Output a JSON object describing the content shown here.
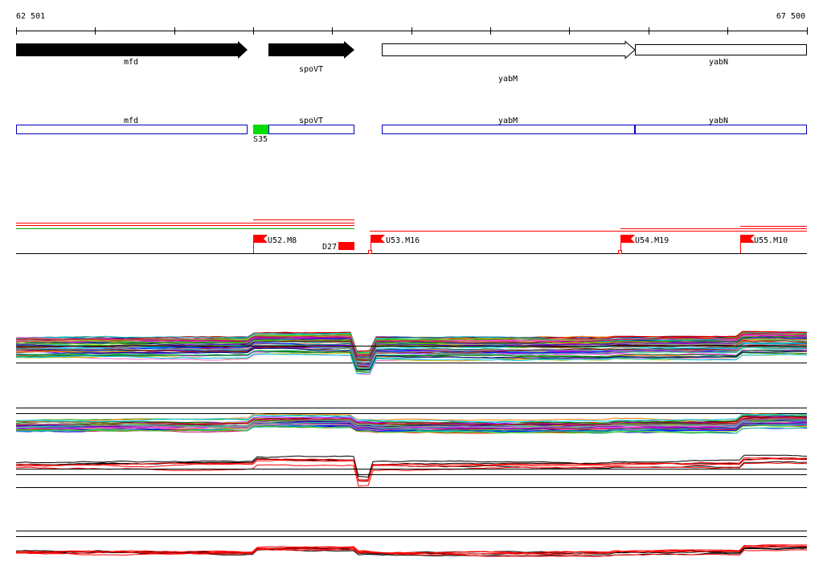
{
  "ruler": {
    "start_label": "62 501",
    "end_label": "67 500"
  },
  "genes": [
    {
      "label": "mfd",
      "style": "filled"
    },
    {
      "label": "spoVT",
      "style": "filled"
    },
    {
      "label": "yabM",
      "style": "outline"
    },
    {
      "label": "yabN",
      "style": "outline"
    }
  ],
  "annotation_boxes": [
    {
      "label": "mfd"
    },
    {
      "label": "spoVT"
    },
    {
      "label": "yabM"
    },
    {
      "label": "yabN"
    }
  ],
  "marker": {
    "label": "S35",
    "color": "#00dd00"
  },
  "flags": [
    {
      "label": "U52.M8",
      "color": "#ff0000"
    },
    {
      "label": "U53.M16",
      "color": "#ff0000"
    },
    {
      "label": "U54.M19",
      "color": "#ff0000"
    },
    {
      "label": "U55.M10",
      "color": "#ff0000"
    }
  ],
  "deletion": {
    "label": "D27",
    "color": "#ff0000"
  },
  "colors": {
    "line_primary": "#ff0000",
    "line_secondary": "#000000",
    "box_outline": "#0000c0"
  }
}
